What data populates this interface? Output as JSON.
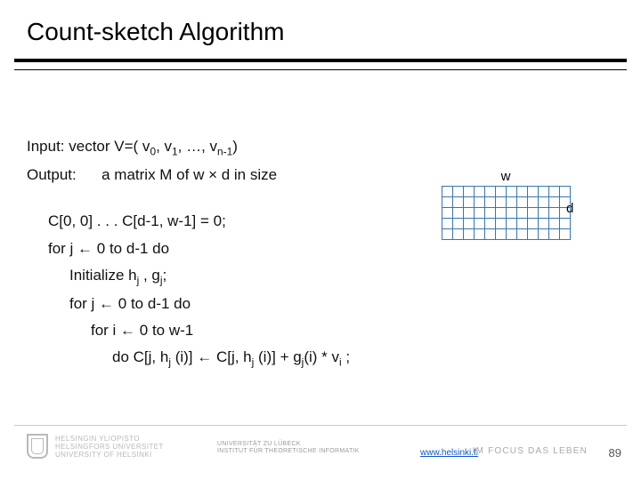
{
  "title": "Count-sketch Algorithm",
  "lines": {
    "input_prefix": "Input: vector V=( v",
    "input_sub0": "0",
    "input_mid1": ", v",
    "input_sub1": "1",
    "input_mid2": ", …, v",
    "input_sub_nminus1": "n-1",
    "input_suffix": ")",
    "output_label": "Output:",
    "output_text": "a matrix M of  w × d in size",
    "init_c": "C[0, 0] . . . C[d-1, w-1] = 0;",
    "for_j_outer": "for j ← 0 to d-1 do",
    "initialize_prefix": "Initialize h",
    "initialize_sub1": "j",
    "initialize_mid": " , g",
    "initialize_sub2": "j",
    "initialize_suffix": ";",
    "for_j_inner": "for j ← 0 to d-1 do",
    "for_i": "for i ← 0 to w-1",
    "do_prefix": "do C[j, h",
    "do_sub_a": "j",
    "do_mid1": " (i)] ← C[j, h",
    "do_sub_b": "j",
    "do_mid2": " (i)] + g",
    "do_sub_c": "j",
    "do_mid3": "(i) * v",
    "do_sub_d": "i",
    "do_suffix": " ;"
  },
  "matrix": {
    "top_label": "w",
    "right_label": "d",
    "cols": 12,
    "rows": 5
  },
  "footer": {
    "helsinki_line1": "HELSINGIN YLIOPISTO",
    "helsinki_line2": "HELSINGFORS UNIVERSITET",
    "helsinki_line3": "UNIVERSITY OF HELSINKI",
    "lubeck_line1": "UNIVERSITÄT ZU LÜBECK",
    "lubeck_line2": "INSTITUT FÜR THEORETISCHE INFORMATIK",
    "url_text": "www.helsinki.fi",
    "focus_text": "IM FOCUS DAS LEBEN",
    "page_number": "89"
  }
}
